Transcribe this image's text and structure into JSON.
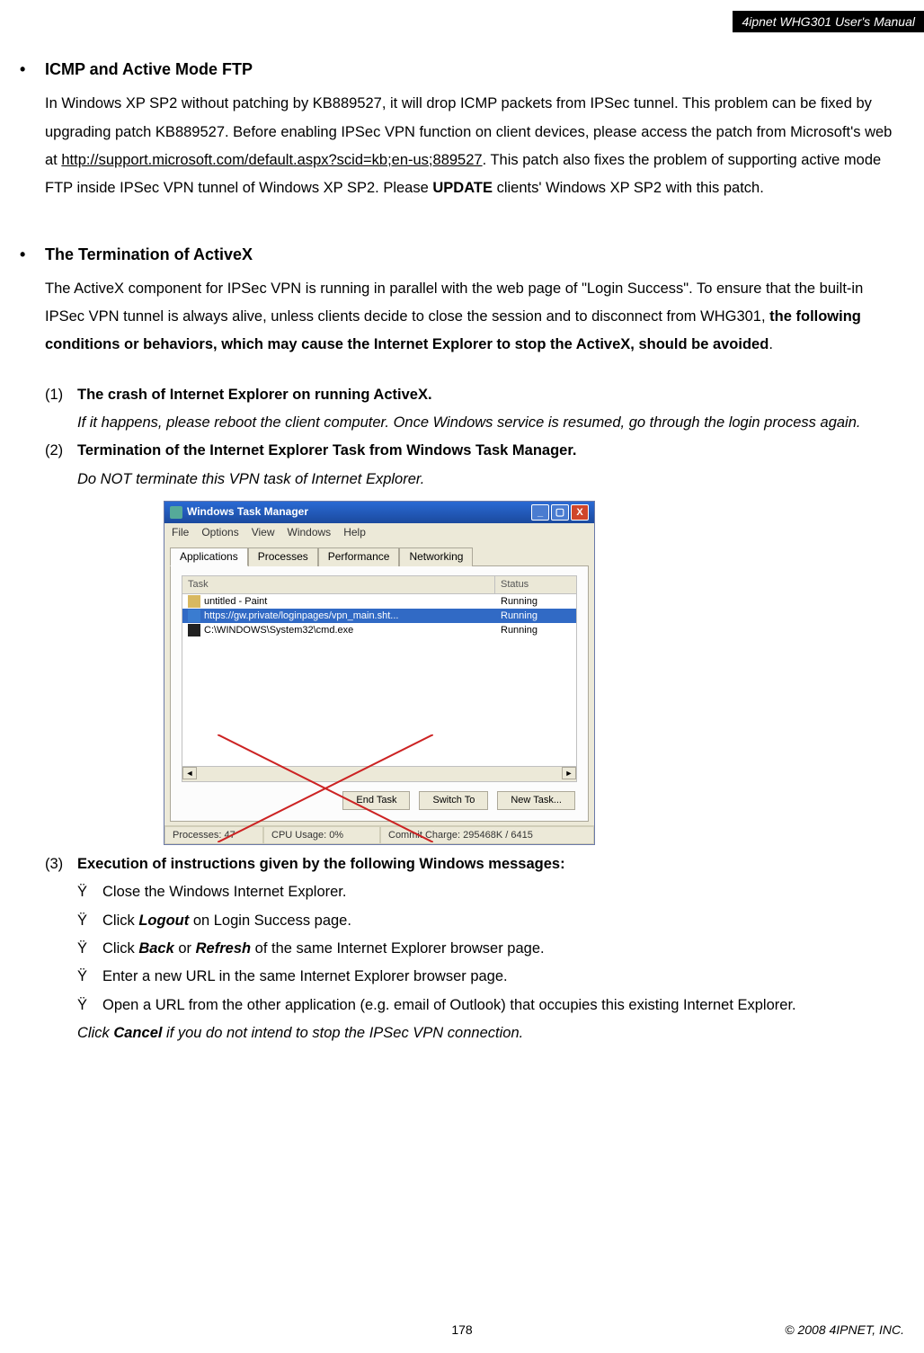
{
  "header": {
    "title": "4ipnet WHG301 User's Manual"
  },
  "section_icmp": {
    "heading": "ICMP and Active Mode FTP",
    "p1_pre": "In Windows XP SP2 without patching by KB889527, it will drop ICMP packets from IPSec tunnel. This problem can be fixed by upgrading patch KB889527. Before enabling IPSec VPN function on client devices, please access the patch from Microsoft's web at ",
    "p1_link": "http://support.microsoft.com/default.aspx?scid=kb;en-us;889527",
    "p1_post": ". This patch also fixes the problem of supporting active mode FTP inside IPSec VPN tunnel of Windows XP SP2. Please ",
    "p1_bold": "UPDATE",
    "p1_tail": " clients' Windows XP SP2 with this patch."
  },
  "section_activex": {
    "heading": "The Termination of ActiveX",
    "p1_a": "The ActiveX component for IPSec VPN is running in parallel with the web page of \"Login Success\". To ensure that the built-in IPSec VPN tunnel is always alive, unless clients decide to close the session and to disconnect from WHG301, ",
    "p1_bold": "the following conditions or behaviors, which may cause the Internet Explorer to stop the ActiveX, should be avoided",
    "p1_b": ".",
    "items": {
      "n1": "(1)",
      "n1_title": "The crash of Internet Explorer on running ActiveX.",
      "n1_body": "If it happens, please reboot the client computer. Once Windows service is resumed, go through the login process again.",
      "n2": "(2)",
      "n2_title": "Termination of the Internet Explorer Task from Windows Task Manager.",
      "n2_body": "Do NOT terminate this VPN task of Internet Explorer.",
      "n3": "(3)",
      "n3_title": "Execution of instructions given by the following Windows messages:"
    },
    "subitems": {
      "mark": "Ÿ",
      "s1": "Close the Windows Internet Explorer.",
      "s2_a": "Click ",
      "s2_b": "Logout",
      "s2_c": " on Login Success page.",
      "s3_a": "Click ",
      "s3_b": "Back",
      "s3_c": " or ",
      "s3_d": "Refresh",
      "s3_e": " of the same Internet Explorer browser page.",
      "s4": "Enter a new URL in the same Internet Explorer browser page.",
      "s5": "Open a URL from the other application (e.g. email of Outlook) that occupies this existing Internet Explorer.",
      "note_a": "Click ",
      "note_b": "Cancel",
      "note_c": " if you do not intend to stop the IPSec VPN connection."
    }
  },
  "taskmgr": {
    "title": "Windows Task Manager",
    "menu": [
      "File",
      "Options",
      "View",
      "Windows",
      "Help"
    ],
    "tabs": [
      "Applications",
      "Processes",
      "Performance",
      "Networking"
    ],
    "cols": {
      "task": "Task",
      "status": "Status"
    },
    "rows": [
      {
        "name": "untitled - Paint",
        "status": "Running",
        "selected": false
      },
      {
        "name": "https://gw.private/loginpages/vpn_main.sht...",
        "status": "Running",
        "selected": true
      },
      {
        "name": "C:\\WINDOWS\\System32\\cmd.exe",
        "status": "Running",
        "selected": false
      }
    ],
    "buttons": {
      "end": "End Task",
      "switch": "Switch To",
      "new": "New Task..."
    },
    "status": {
      "processes": "Processes: 47",
      "cpu": "CPU Usage: 0%",
      "commit": "Commit Charge: 295468K / 6415"
    }
  },
  "footer": {
    "page": "178",
    "copyright": "© 2008 4IPNET, INC."
  }
}
